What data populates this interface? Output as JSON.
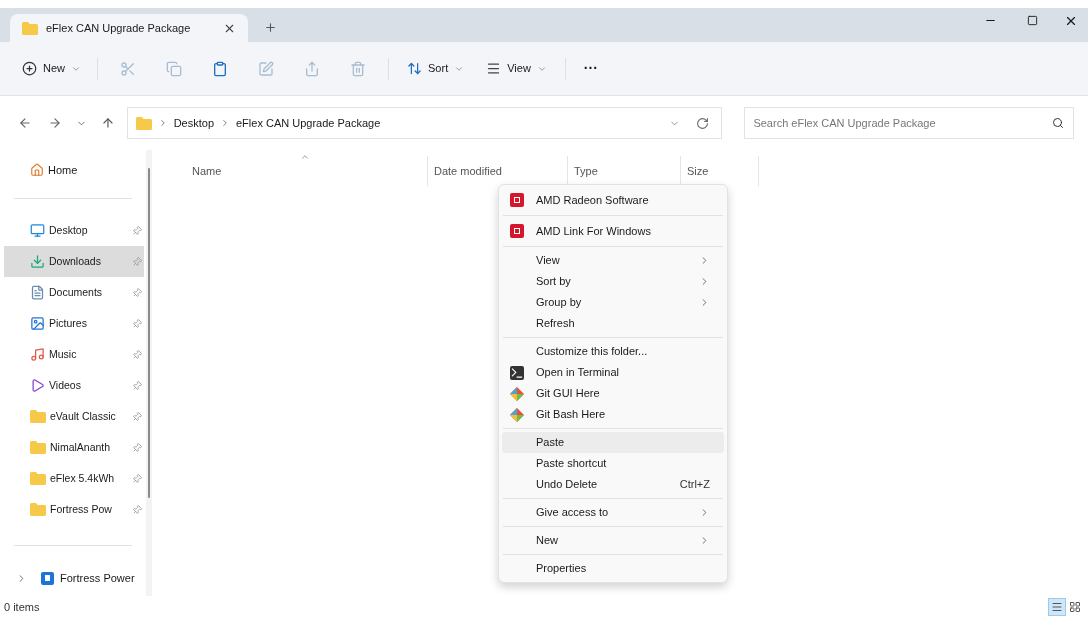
{
  "tabs": [
    {
      "label": "eFlex CAN Upgrade Package",
      "selected": true
    }
  ],
  "toolbar": {
    "new_label": "New",
    "actions": [
      {
        "kind": "cut",
        "disabled": true
      },
      {
        "kind": "copy",
        "disabled": true
      },
      {
        "kind": "paste",
        "disabled": false
      },
      {
        "kind": "rename",
        "disabled": true
      },
      {
        "kind": "share",
        "disabled": true
      },
      {
        "kind": "delete",
        "disabled": true
      }
    ],
    "sort_label": "Sort",
    "view_label": "View",
    "more_label": "···"
  },
  "address": {
    "breadcrumbs": [
      "Desktop",
      "eFlex CAN Upgrade Package"
    ],
    "search_placeholder": "Search eFlex CAN Upgrade Package"
  },
  "sidebar": {
    "home": "Home",
    "pinned": [
      {
        "label": "Desktop",
        "kind": "desktop",
        "selected": false
      },
      {
        "label": "Downloads",
        "kind": "downloads",
        "selected": true
      },
      {
        "label": "Documents",
        "kind": "documents",
        "selected": false
      },
      {
        "label": "Pictures",
        "kind": "pictures",
        "selected": false
      },
      {
        "label": "Music",
        "kind": "music",
        "selected": false
      },
      {
        "label": "Videos",
        "kind": "videos",
        "selected": false
      },
      {
        "label": "eVault Classic",
        "kind": "folder",
        "selected": false
      },
      {
        "label": "NimalAnanth",
        "kind": "folder",
        "selected": false
      },
      {
        "label": "eFlex 5.4kWh",
        "kind": "folder",
        "selected": false
      },
      {
        "label": "Fortress Pow",
        "kind": "folder",
        "selected": false
      }
    ],
    "drives": [
      {
        "label": "Fortress Power",
        "expanded": false
      }
    ]
  },
  "columns": [
    "Name",
    "Date modified",
    "Type",
    "Size"
  ],
  "context_menu": [
    [
      {
        "label": "AMD Radeon Software",
        "kind": "amd",
        "selected": false
      }
    ],
    [
      {
        "label": "AMD Link For Windows",
        "kind": "amd",
        "selected": false
      }
    ],
    [
      {
        "label": "View",
        "kind": "plain",
        "submenu": true,
        "selected": false
      },
      {
        "label": "Sort by",
        "kind": "plain",
        "submenu": true,
        "selected": false
      },
      {
        "label": "Group by",
        "kind": "plain",
        "submenu": true,
        "selected": false
      },
      {
        "label": "Refresh",
        "kind": "plain",
        "selected": false
      }
    ],
    [
      {
        "label": "Customize this folder...",
        "kind": "plain",
        "selected": false
      },
      {
        "label": "Open in Terminal",
        "kind": "terminal",
        "selected": false
      },
      {
        "label": "Git GUI Here",
        "kind": "git",
        "selected": false
      },
      {
        "label": "Git Bash Here",
        "kind": "git",
        "selected": false
      }
    ],
    [
      {
        "label": "Paste",
        "kind": "plain",
        "selected": true
      },
      {
        "label": "Paste shortcut",
        "kind": "plain",
        "selected": false
      },
      {
        "label": "Undo Delete",
        "kind": "plain",
        "shortcut": "Ctrl+Z",
        "selected": false
      }
    ],
    [
      {
        "label": "Give access to",
        "kind": "plain",
        "submenu": true,
        "selected": false
      }
    ],
    [
      {
        "label": "New",
        "kind": "plain",
        "submenu": true,
        "selected": false
      }
    ],
    [
      {
        "label": "Properties",
        "kind": "plain",
        "selected": false
      }
    ]
  ],
  "status_bar": {
    "count": "0 items",
    "view_buttons": [
      {
        "kind": "details",
        "selected": true
      },
      {
        "kind": "tiles",
        "selected": false
      }
    ]
  }
}
